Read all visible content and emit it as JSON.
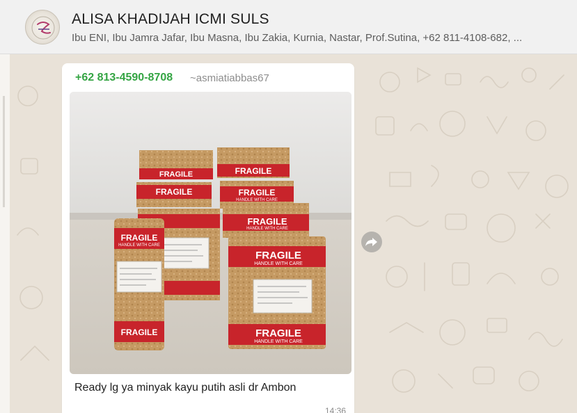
{
  "header": {
    "group_name": "ALISA KHADIJAH ICMI SULS",
    "members": "Ibu ENI, Ibu Jamra Jafar, Ibu Masna, Ibu Zakia, Kurnia, Nastar, Prof.Sutina, +62 811-4108-682, ...",
    "avatar_icon": "group-logo-icon"
  },
  "message": {
    "sender_phone": "+62 813-4590-8708",
    "sender_alias": "~asmiatiabbas67",
    "photo": {
      "description_icon": "package-photo",
      "label_main": "FRAGILE",
      "label_sub": "HANDLE WITH CARE"
    },
    "caption": "Ready lg ya minyak kayu putih asli dr Ambon",
    "time": "14:36"
  },
  "actions": {
    "forward_icon": "forward-icon"
  },
  "colors": {
    "sender_name": "#35a544",
    "header_bg": "#f1f1f1",
    "wallpaper": "#e9e2d8",
    "bubble": "#ffffff",
    "fragile_red": "#c8242b",
    "package_tan": "#c79a62"
  }
}
